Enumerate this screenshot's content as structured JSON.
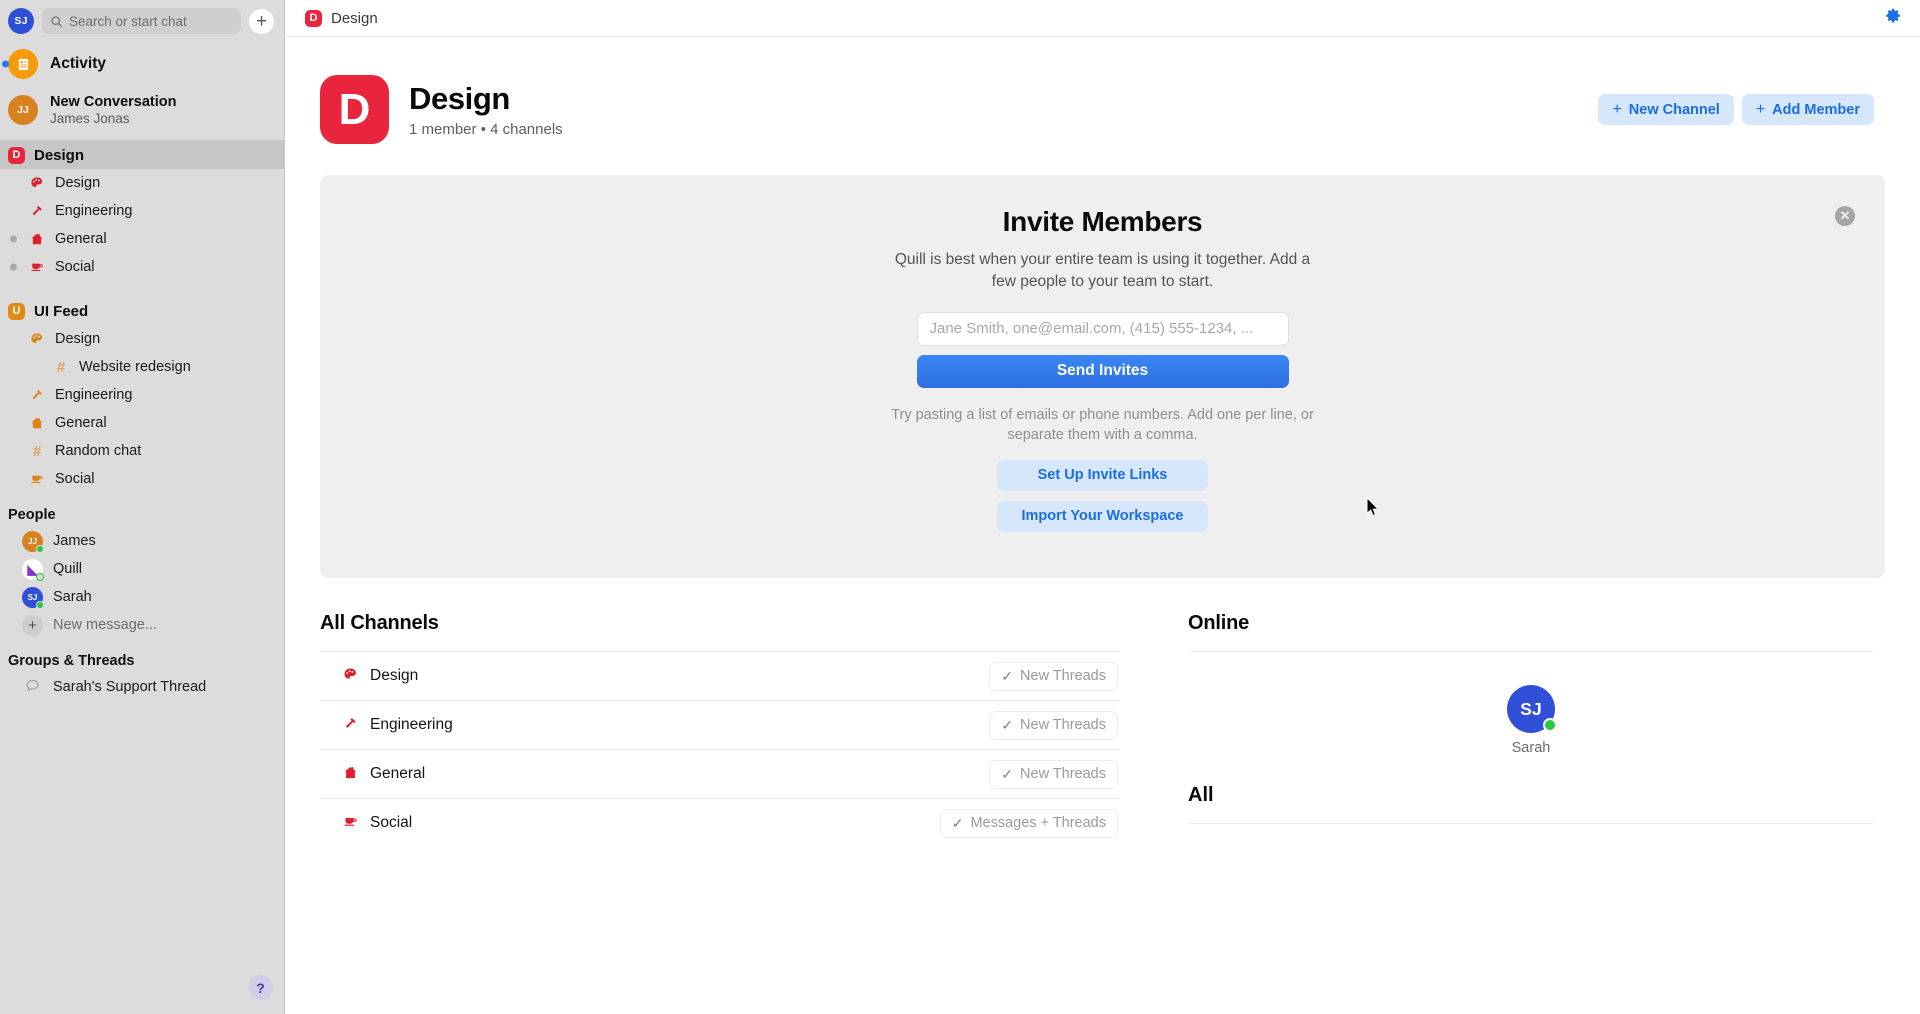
{
  "sidebar": {
    "user_avatar": {
      "initials": "SJ",
      "name": "avatar-sj"
    },
    "search": {
      "placeholder": "Search or start chat",
      "icon": "search-icon"
    },
    "compose_icon": "plus-icon",
    "activity": {
      "label": "Activity",
      "icon": "activity-icon",
      "has_unread": true
    },
    "conversation": {
      "title": "New Conversation",
      "subtitle": "James Jonas",
      "initials": "JJ"
    },
    "workspaces": [
      {
        "name": "Design",
        "badge_letter": "D",
        "badge_color": "#e8253c",
        "selected": true,
        "channels": [
          {
            "label": "Design",
            "icon": "palette-icon",
            "unread": false,
            "indent": 1
          },
          {
            "label": "Engineering",
            "icon": "hammer-icon",
            "unread": false,
            "indent": 1
          },
          {
            "label": "General",
            "icon": "house-icon",
            "unread": true,
            "indent": 1
          },
          {
            "label": "Social",
            "icon": "coffee-icon",
            "unread": true,
            "indent": 1
          }
        ]
      },
      {
        "name": "UI Feed",
        "badge_letter": "U",
        "badge_color": "#e08a14",
        "selected": false,
        "channels": [
          {
            "label": "Design",
            "icon": "palette-icon",
            "unread": false,
            "indent": 1
          },
          {
            "label": "Website redesign",
            "icon": "hash-icon",
            "unread": false,
            "indent": 2
          },
          {
            "label": "Engineering",
            "icon": "hammer-icon",
            "unread": false,
            "indent": 1
          },
          {
            "label": "General",
            "icon": "house-icon",
            "unread": false,
            "indent": 1
          },
          {
            "label": "Random chat",
            "icon": "hash-icon",
            "unread": false,
            "indent": 1
          },
          {
            "label": "Social",
            "icon": "coffee-icon",
            "unread": false,
            "indent": 1
          }
        ]
      }
    ],
    "people_title": "People",
    "people": [
      {
        "name": "James",
        "initials": "JJ",
        "status": "online"
      },
      {
        "name": "Quill",
        "initials": "Q",
        "status": "away"
      },
      {
        "name": "Sarah",
        "initials": "SJ",
        "status": "online"
      }
    ],
    "new_message": {
      "label": "New message...",
      "icon": "plus-icon"
    },
    "groups_title": "Groups & Threads",
    "groups": [
      {
        "label": "Sarah's Support Thread",
        "icon": "speech-bubble-icon"
      }
    ],
    "help": {
      "label": "?",
      "icon": "help-icon"
    }
  },
  "topbar": {
    "title": "Design",
    "badge_letter": "D",
    "settings_icon": "gear-icon"
  },
  "page": {
    "workspace_letter": "D",
    "workspace_name": "Design",
    "workspace_meta": "1 member • 4 channels",
    "new_channel_label": "New Channel",
    "add_member_label": "Add Member"
  },
  "invite": {
    "title": "Invite Members",
    "subtitle": "Quill is best when your entire team is using it together. Add a few people to your team to start.",
    "input_value": "",
    "input_placeholder": "Jane Smith, one@email.com, (415) 555-1234, ...",
    "send_label": "Send Invites",
    "hint": "Try pasting a list of emails or phone numbers. Add one per line, or separate them with a comma.",
    "invite_links_label": "Set Up Invite Links",
    "import_label": "Import Your Workspace",
    "close_icon": "close-icon"
  },
  "channels_section": {
    "title": "All Channels",
    "items": [
      {
        "label": "Design",
        "icon": "palette-icon",
        "badge": "New Threads"
      },
      {
        "label": "Engineering",
        "icon": "hammer-icon",
        "badge": "New Threads"
      },
      {
        "label": "General",
        "icon": "house-icon",
        "badge": "New Threads"
      },
      {
        "label": "Social",
        "icon": "coffee-icon",
        "badge": "Messages + Threads"
      }
    ]
  },
  "online_section": {
    "title": "Online",
    "all_title": "All",
    "people": [
      {
        "name": "Sarah",
        "initials": "SJ",
        "status": "online"
      }
    ]
  },
  "colors": {
    "accent_blue": "#1b6ee0",
    "button_blue": "#3a87f5",
    "design_red": "#e8253c",
    "uifeed_orange": "#e08a14",
    "online_green": "#28c840",
    "sidebar_bg": "#dcdcdc"
  }
}
